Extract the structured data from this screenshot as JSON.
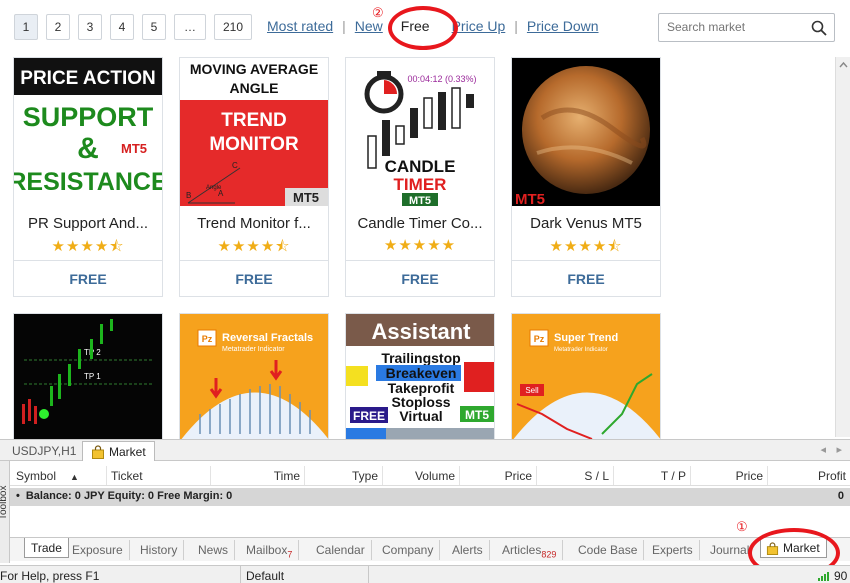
{
  "pagination": {
    "pages": [
      "1",
      "2",
      "3",
      "4",
      "5",
      "…",
      "210"
    ],
    "active": "1"
  },
  "sort_links": {
    "most_rated": "Most rated",
    "new": "New",
    "free": "Free",
    "price_up": "Price Up",
    "price_down": "Price Down",
    "separator": "|"
  },
  "annotations": {
    "free_marker": "②",
    "market_marker": "①",
    "circle_color": "#e8171d"
  },
  "search": {
    "placeholder": "Search market",
    "icon": "search-icon"
  },
  "products": [
    {
      "name": "PR Support And...",
      "price": "FREE",
      "rating": 4.5,
      "stars": "★★★★⯪",
      "thumb_text": [
        "PRICE ACTION",
        "SUPPORT",
        "&",
        "RESISTANCE",
        "MT5"
      ]
    },
    {
      "name": "Trend Monitor f...",
      "price": "FREE",
      "rating": 4.5,
      "stars": "★★★★⯪",
      "thumb_text": [
        "MOVING AVERAGE",
        "ANGLE",
        "TREND",
        "MONITOR",
        "MT5",
        "C",
        "B",
        "A",
        "Angle"
      ]
    },
    {
      "name": "Candle Timer Co...",
      "price": "FREE",
      "rating": 5,
      "stars": "★★★★★",
      "thumb_text": [
        "00:04:12 (0.33%)",
        "CANDLE",
        "TIMER",
        "MT5"
      ]
    },
    {
      "name": "Dark Venus MT5",
      "price": "FREE",
      "rating": 4.5,
      "stars": "★★★★⯪",
      "thumb_text": [
        "MT5"
      ]
    }
  ],
  "products_row2": [
    {
      "thumb_text": [
        "TP 2",
        "TP 1"
      ]
    },
    {
      "thumb_text": [
        "Pz",
        "Reversal Fractals",
        "Metatrader Indicator"
      ]
    },
    {
      "thumb_text": [
        "Assistant",
        "Trailingstop",
        "Breakeven",
        "Takeprofit",
        "Stoploss",
        "FREE",
        "Virtual",
        "MT5"
      ]
    },
    {
      "thumb_text": [
        "Pz",
        "Super Trend",
        "Metatrader Indicator",
        "Sell"
      ]
    }
  ],
  "chart_tabs": {
    "chart": "USDJPY,H1",
    "market": "Market"
  },
  "terminal": {
    "columns": [
      "Symbol",
      "Ticket",
      "Time",
      "Type",
      "Volume",
      "Price",
      "S / L",
      "T / P",
      "Price",
      "Profit"
    ],
    "balance": "Balance: 0 JPY  Equity: 0  Free Margin: 0",
    "balance_profit": "0",
    "toolbox_label": "Toolbox"
  },
  "bottom_tabs": {
    "trade": "Trade",
    "exposure": "Exposure",
    "history": "History",
    "news": "News",
    "mailbox": "Mailbox",
    "mailbox_count": "7",
    "calendar": "Calendar",
    "company": "Company",
    "alerts": "Alerts",
    "articles": "Articles",
    "articles_count": "829",
    "codebase": "Code Base",
    "experts": "Experts",
    "journal": "Journal",
    "market": "Market"
  },
  "status": {
    "help": "For Help, press F1",
    "profile": "Default",
    "right": "90"
  }
}
